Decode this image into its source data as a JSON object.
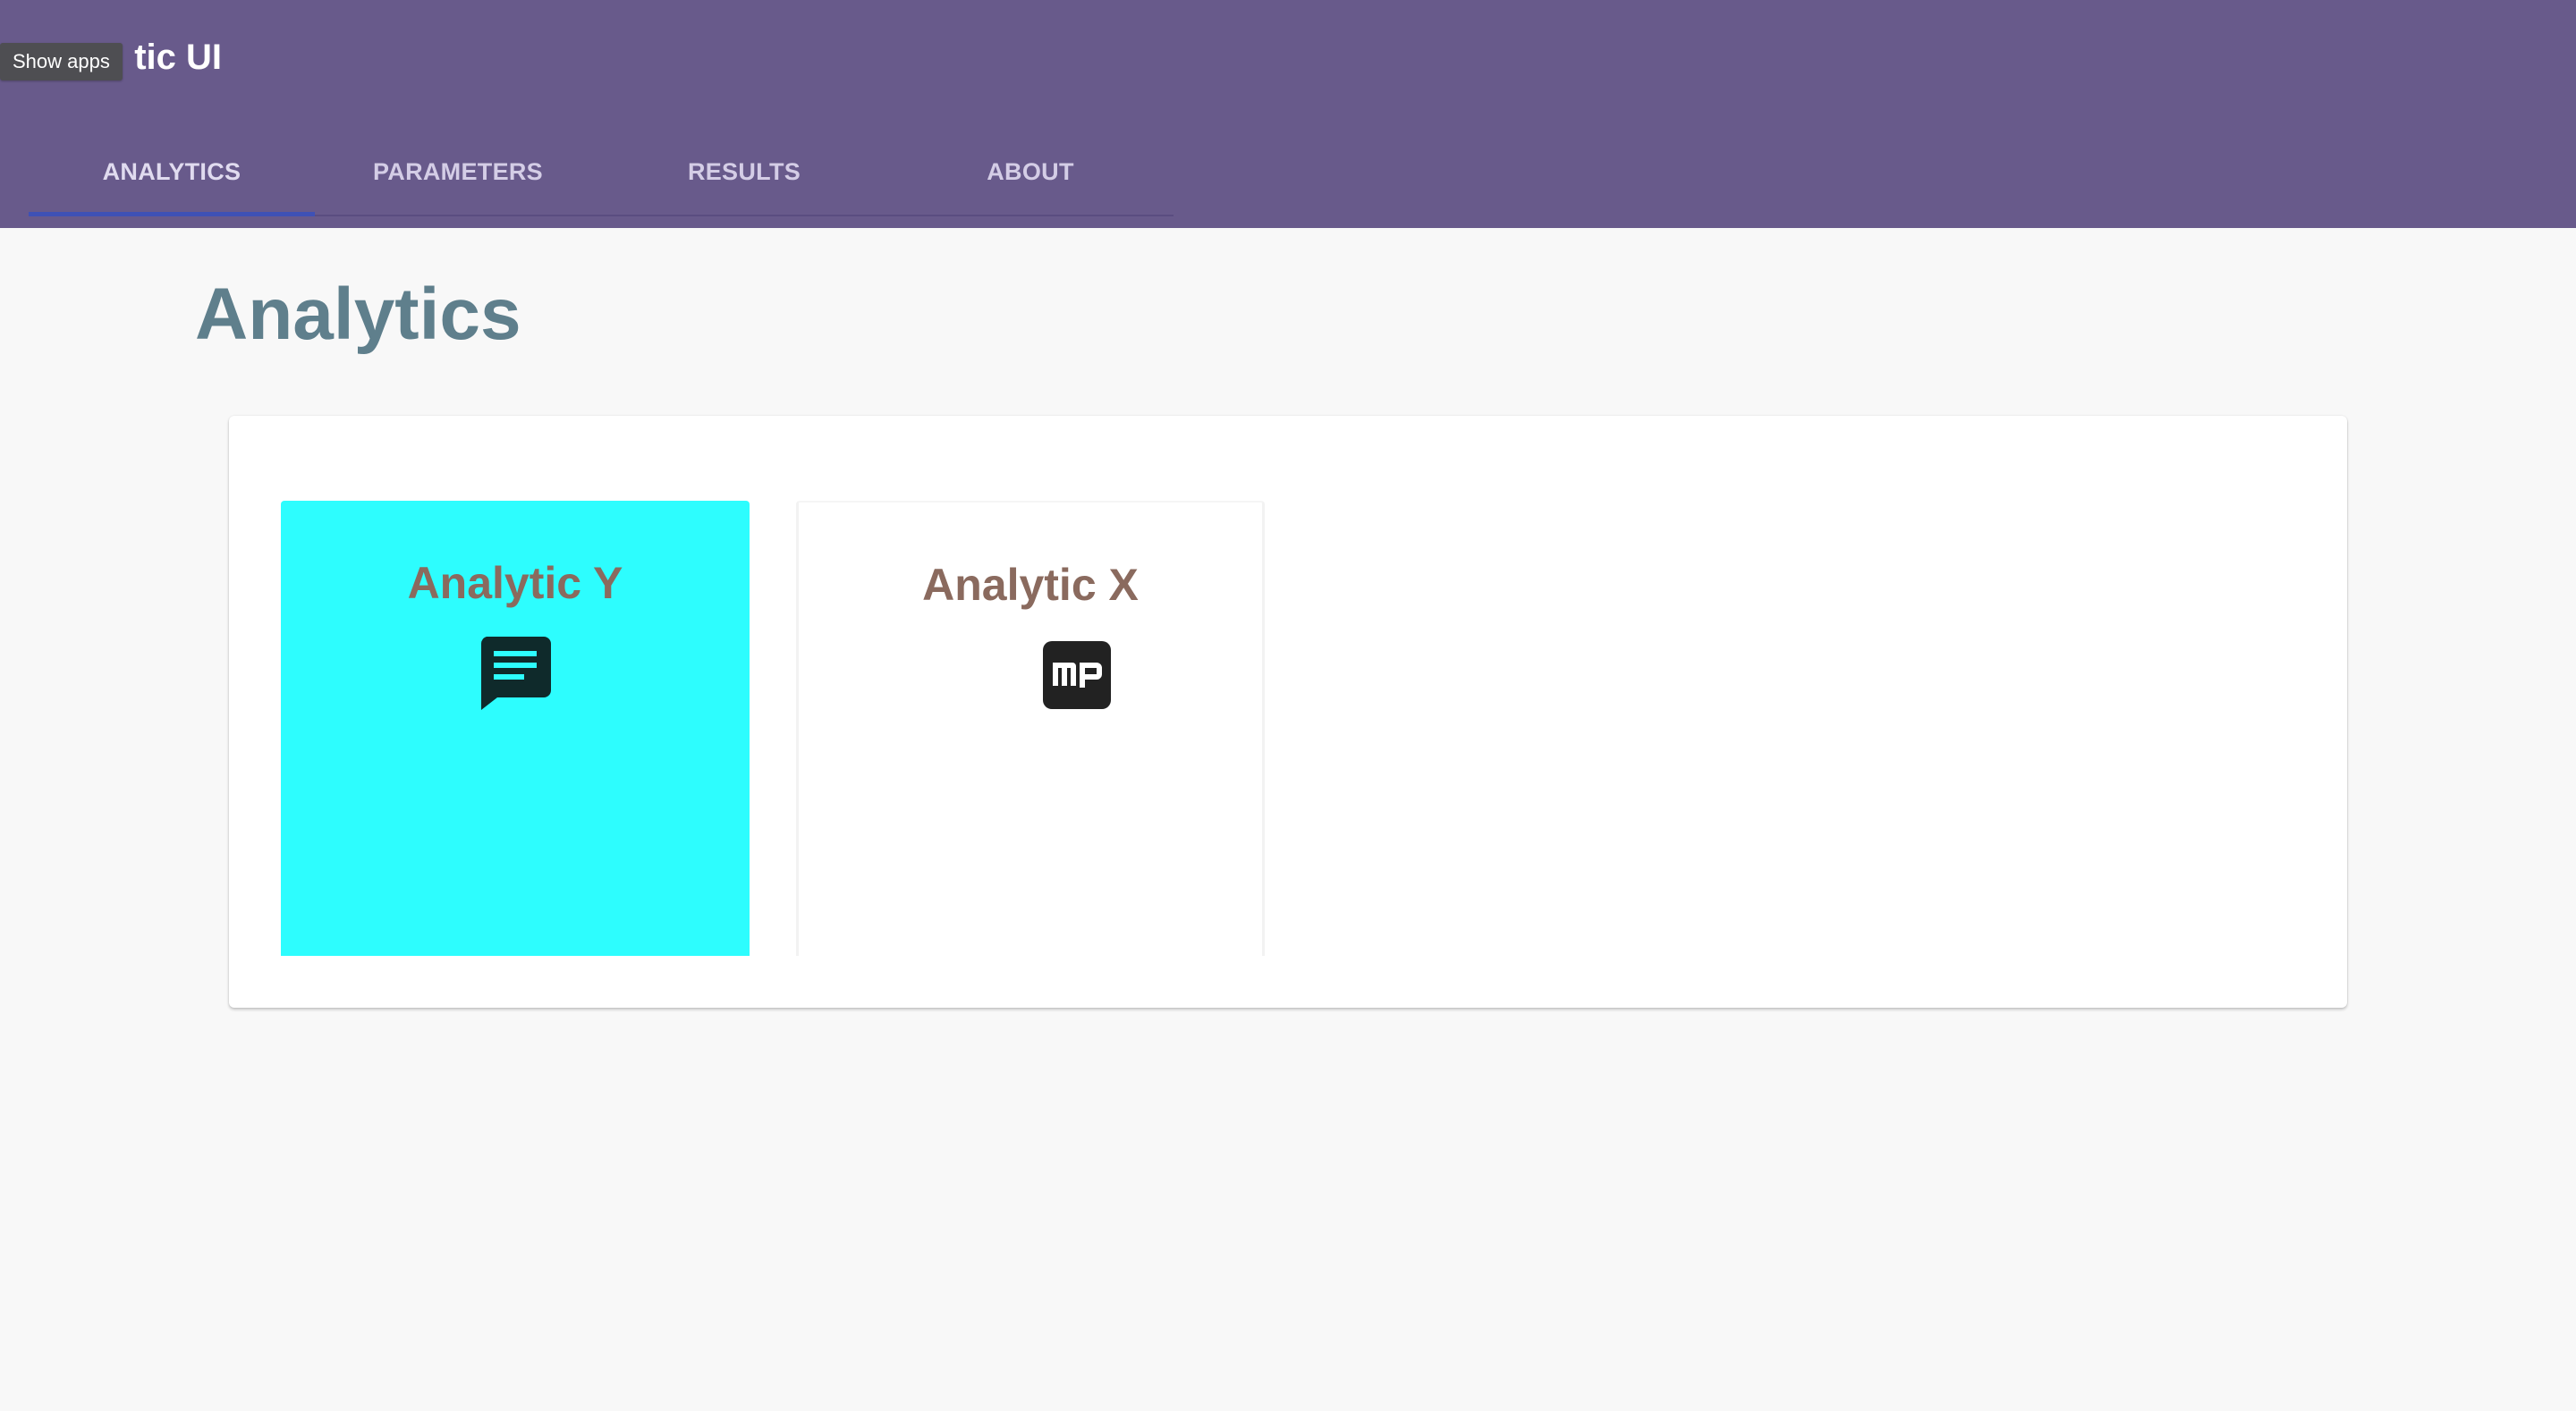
{
  "app": {
    "title": "tic UI",
    "tooltip": "Show apps"
  },
  "tabs": [
    {
      "label": "ANALYTICS",
      "active": true
    },
    {
      "label": "PARAMETERS",
      "active": false
    },
    {
      "label": "RESULTS",
      "active": false
    },
    {
      "label": "ABOUT",
      "active": false
    }
  ],
  "main": {
    "title": "Analytics",
    "tiles": [
      {
        "title": "Analytic Y",
        "icon": "chat-message-icon",
        "color": "#2dfdfe"
      },
      {
        "title": "Analytic X",
        "icon": "mp-logo-icon",
        "color": "#ffffff"
      }
    ]
  },
  "colors": {
    "header": "#685a8b",
    "accent": "#3f51b5",
    "page_title": "#5f7f8c",
    "tile_title": "#8a6a5e"
  }
}
